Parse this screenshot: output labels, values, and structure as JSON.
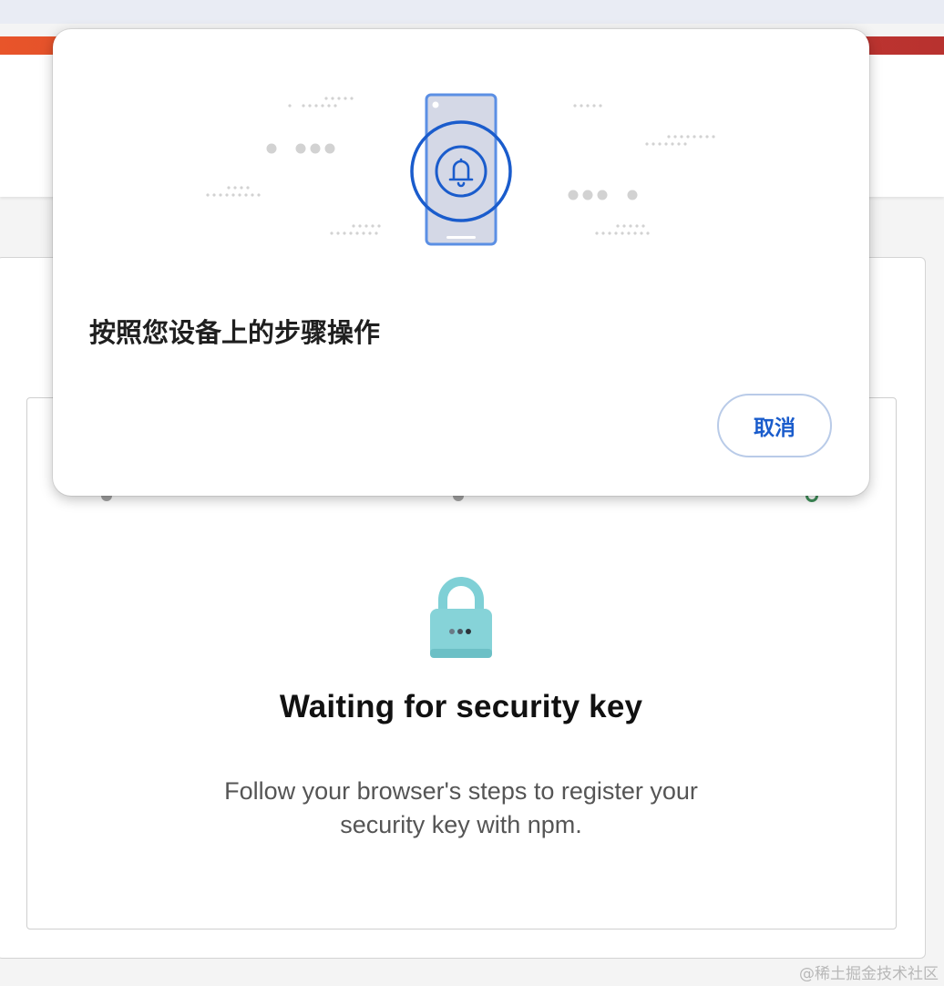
{
  "dialog": {
    "title": "按照您设备上的步骤操作",
    "cancel_label": "取消",
    "illustration_icon": "bell-icon",
    "accent_color": "#1a5ccc"
  },
  "main": {
    "title": "Waiting for security key",
    "description": "Follow your browser's steps to register your security key with npm.",
    "lock_icon": "lock-icon",
    "lock_color": "#7fd0d6"
  },
  "watermark": "@稀土掘金技术社区"
}
